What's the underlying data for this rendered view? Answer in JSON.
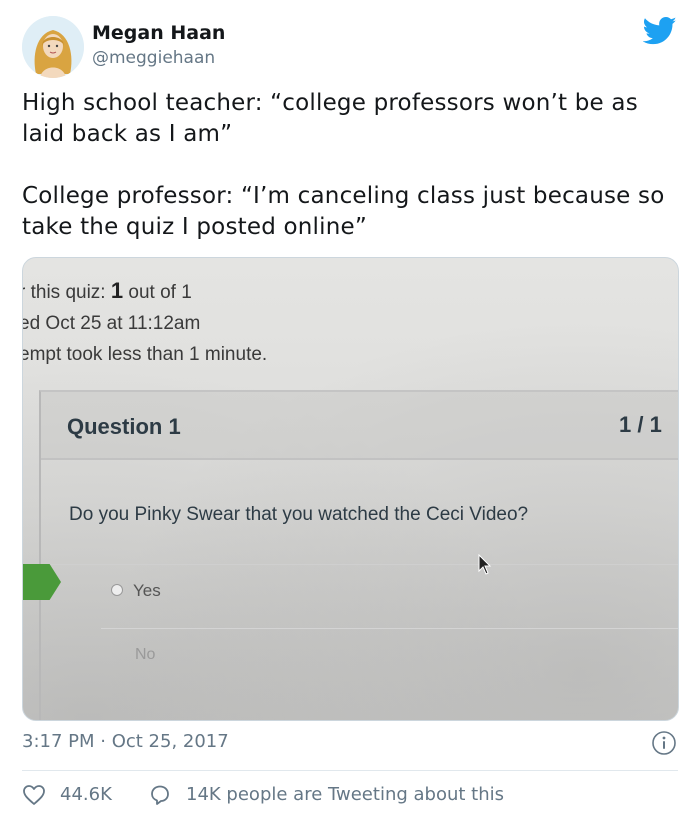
{
  "author": {
    "name": "Megan Haan",
    "handle": "@meggiehaan"
  },
  "tweet": {
    "text": "High school teacher: “college professors won’t be as laid back as I am”\n\nCollege professor: “I’m canceling class just because so take the quiz I posted online”",
    "timestamp": "3:17 PM · Oct 25, 2017",
    "likes": "44.6K",
    "tweeting_text": "14K people are Tweeting about this"
  },
  "photo": {
    "score_prefix": "r this quiz: ",
    "score_value": "1",
    "score_suffix": " out of 1",
    "submitted": "ed Oct 25 at 11:12am",
    "attempt": "empt took less than 1 minute.",
    "question_title": "Question 1",
    "question_score": "1 / 1",
    "question_text": "Do you Pinky Swear that you watched the Ceci Video?",
    "option_yes": "Yes",
    "option_no": "No"
  },
  "colors": {
    "twitter_blue": "#1da1f2",
    "secondary_text": "#657786",
    "quiz_marker_green": "#4a9a3a"
  },
  "icons": [
    "avatar",
    "twitter-bird-icon",
    "info-icon",
    "heart-icon",
    "reply-bubble-icon",
    "mouse-cursor-icon"
  ]
}
